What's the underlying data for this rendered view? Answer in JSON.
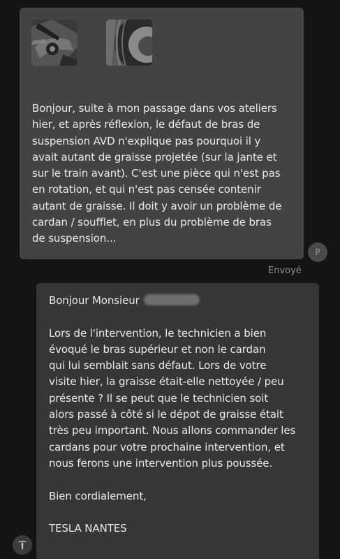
{
  "sent_message": {
    "attachments": [
      {
        "icon": "photo-suspension-arm"
      },
      {
        "icon": "photo-wheel-rim"
      }
    ],
    "lines": [
      "Bonjour, suite à mon passage dans vos ateliers",
      "hier, et après réflexion, le défaut de bras de",
      "suspension AVD n'explique pas pourquoi il y",
      "avait autant de graisse projetée (sur la jante et",
      "sur le train avant). C'est une pièce qui n'est pas",
      "en rotation, et qui n'est pas censée contenir",
      "autant de graisse. Il doit y avoir un problème de",
      "cardan / soufflet, en plus du problème de bras",
      "de suspension..."
    ],
    "avatar_initial": "P",
    "status": "Envoyé"
  },
  "received_message": {
    "greeting": "Bonjour Monsieur",
    "para1": [
      "Lors de l'intervention, le technicien a bien",
      "évoqué le bras supérieur et non le cardan",
      "qui lui semblait sans défaut. Lors de votre",
      "visite hier, la graisse était-elle nettoyée / peu",
      "présente ? Il se peut que le technicien soit",
      "alors passé à côté si le dépot de graisse était",
      "très peu important. Nous allons commander les",
      "cardans pour votre prochaine intervention, et",
      "nous ferons une intervention plus poussée."
    ],
    "closing": "Bien cordialement,",
    "signature": "TESLA NANTES",
    "avatar_icon": "tesla-logo-icon"
  },
  "colors": {
    "background": "#141414",
    "sent_bubble": "#434343",
    "received_bubble": "#363636",
    "text": "#eaeaea",
    "status_text": "#8f8f8f"
  }
}
